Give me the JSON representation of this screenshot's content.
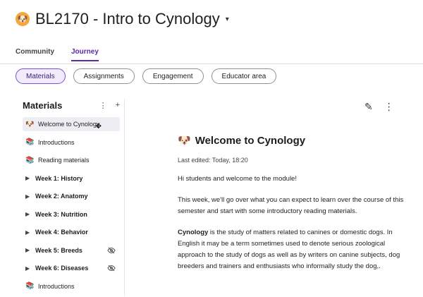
{
  "course": {
    "title": "BL2170 - Intro to Cynology",
    "logo_icon": "dog-emoji"
  },
  "tabs": [
    {
      "label": "Community"
    },
    {
      "label": "Journey",
      "active": true
    }
  ],
  "filters": [
    {
      "label": "Materials",
      "active": true
    },
    {
      "label": "Assignments"
    },
    {
      "label": "Engagement"
    },
    {
      "label": "Educator area"
    }
  ],
  "sidebar": {
    "title": "Materials",
    "items": [
      {
        "type": "page",
        "label": "Welcome to Cynology",
        "selected": true,
        "icon": "dog-emoji"
      },
      {
        "type": "page",
        "label": "Introductions",
        "icon": "books-emoji"
      },
      {
        "type": "page",
        "label": "Reading materials",
        "icon": "stacked-books-emoji"
      },
      {
        "type": "week",
        "label": "Week 1: History"
      },
      {
        "type": "week",
        "label": "Week 2: Anatomy"
      },
      {
        "type": "week",
        "label": "Week 3: Nutrition"
      },
      {
        "type": "week",
        "label": "Week 4: Behavior"
      },
      {
        "type": "week",
        "label": "Week 5: Breeds",
        "hidden": true
      },
      {
        "type": "week",
        "label": "Week 6: Diseases",
        "hidden": true
      },
      {
        "type": "page",
        "label": "Introductions",
        "icon": "books-emoji"
      }
    ]
  },
  "content": {
    "title": "Welcome to Cynology",
    "title_icon": "dog-emoji",
    "last_edited": "Last edited: Today, 18:20",
    "paragraphs": [
      "Hi students and welcome to the module!",
      "This week, we'll go over what you can expect to learn over the course of this semester and start with some introductory reading materials."
    ],
    "definition_term": "Cynology",
    "definition_rest": " is the study of matters related to canines or domestic dogs. In English it may be a term sometimes used to denote serious zoological approach to the study of dogs as well as by writers on canine subjects, dog breeders and trainers and enthusiasts who informally study the dog,."
  }
}
